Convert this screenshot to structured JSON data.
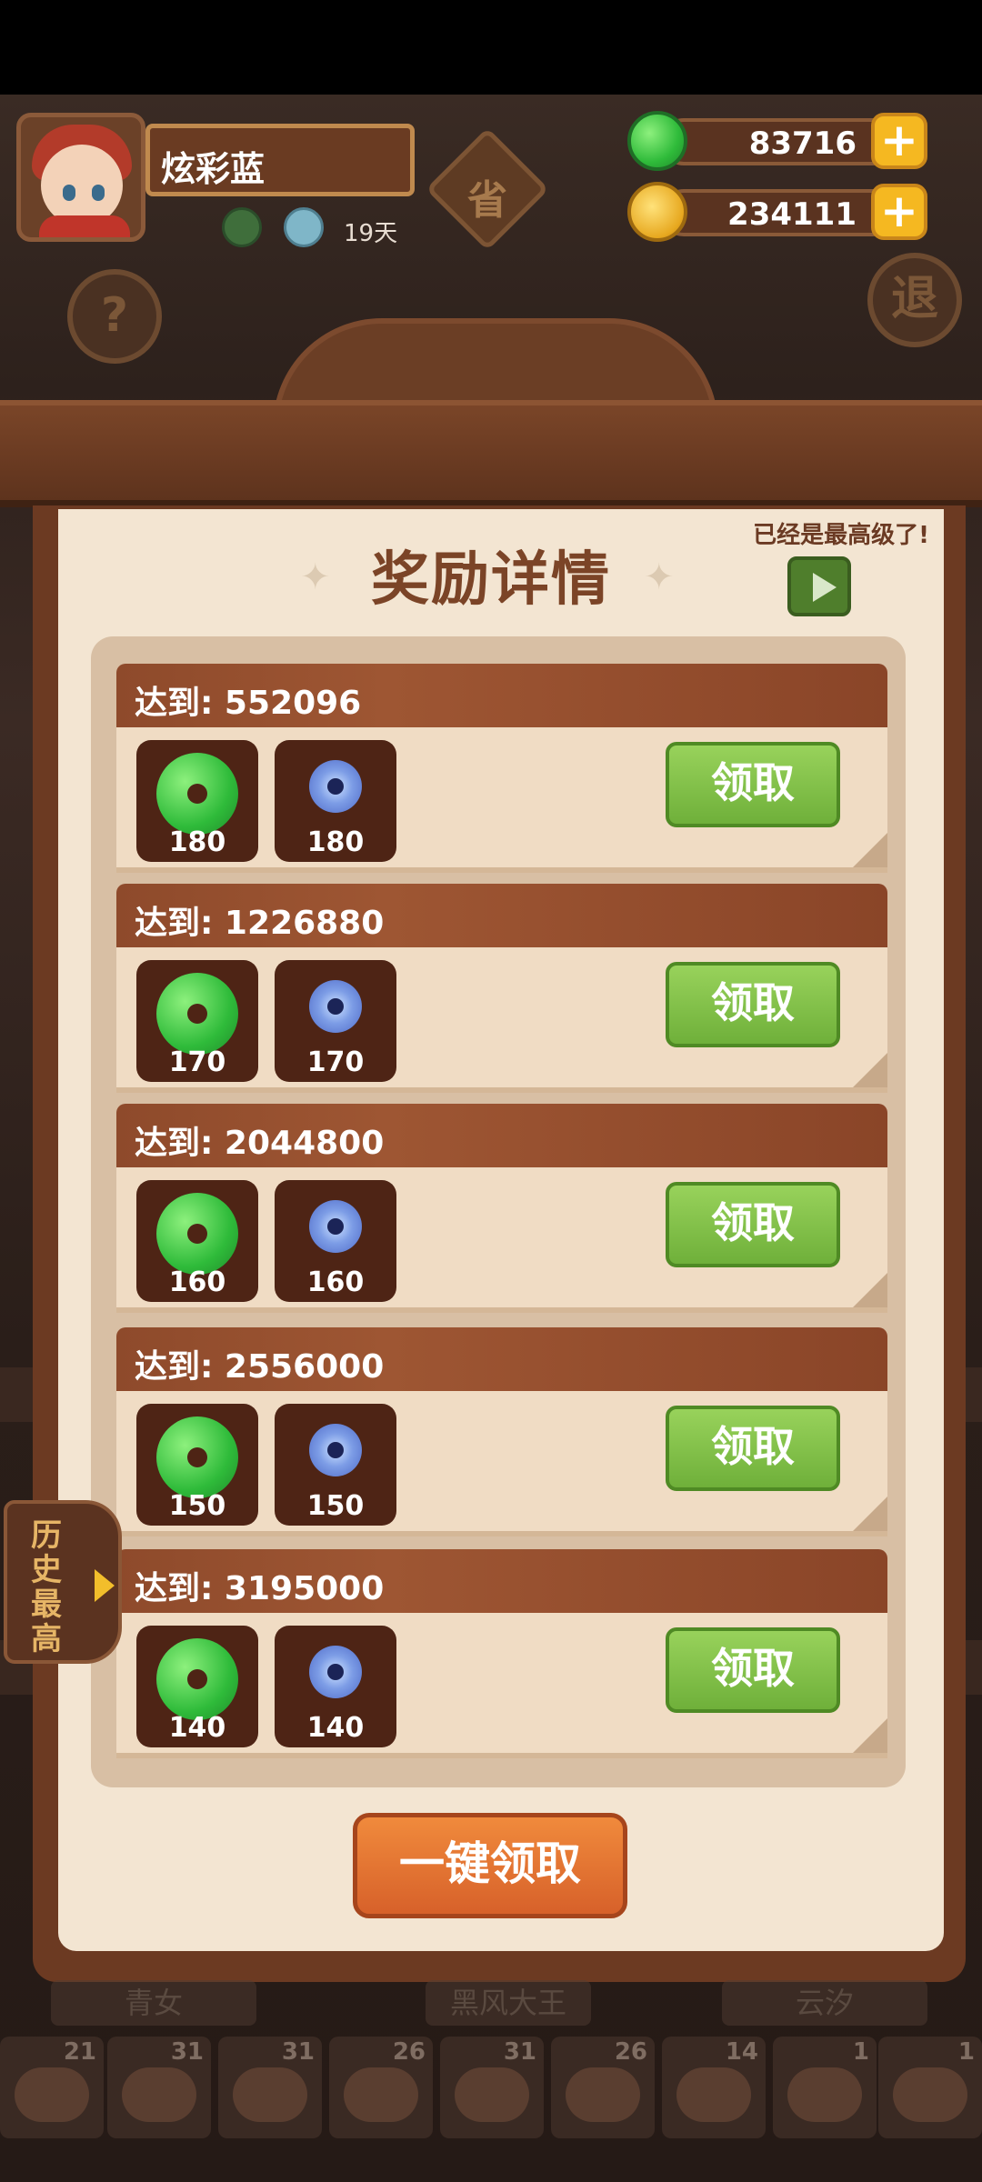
{
  "player": {
    "name": "炫彩蓝",
    "days": "19天"
  },
  "currency": {
    "jade": "83716",
    "coins": "234111"
  },
  "buttons": {
    "help": "?",
    "exit": "退",
    "province": "省"
  },
  "panel": {
    "hint": "已经是最高级了!",
    "title": "奖励详情",
    "one_key_claim": "一键领取",
    "side_tab": "历史最高"
  },
  "rewards": [
    {
      "threshold": "达到: 552096",
      "jade_qty": "180",
      "gem_qty": "180",
      "claim_label": "领取"
    },
    {
      "threshold": "达到: 1226880",
      "jade_qty": "170",
      "gem_qty": "170",
      "claim_label": "领取"
    },
    {
      "threshold": "达到: 2044800",
      "jade_qty": "160",
      "gem_qty": "160",
      "claim_label": "领取"
    },
    {
      "threshold": "达到: 2556000",
      "jade_qty": "150",
      "gem_qty": "150",
      "claim_label": "领取"
    },
    {
      "threshold": "达到: 3195000",
      "jade_qty": "140",
      "gem_qty": "140",
      "claim_label": "领取"
    }
  ],
  "bottom_labels": [
    "青女",
    "黑风大王",
    "云汐"
  ],
  "dishes": [
    "21",
    "31",
    "31",
    "26",
    "31",
    "26",
    "14",
    "1",
    "1"
  ],
  "colors": {
    "accent_green": "#6fb03a",
    "accent_orange": "#d7612a",
    "header_brown": "#8e4a2b"
  }
}
